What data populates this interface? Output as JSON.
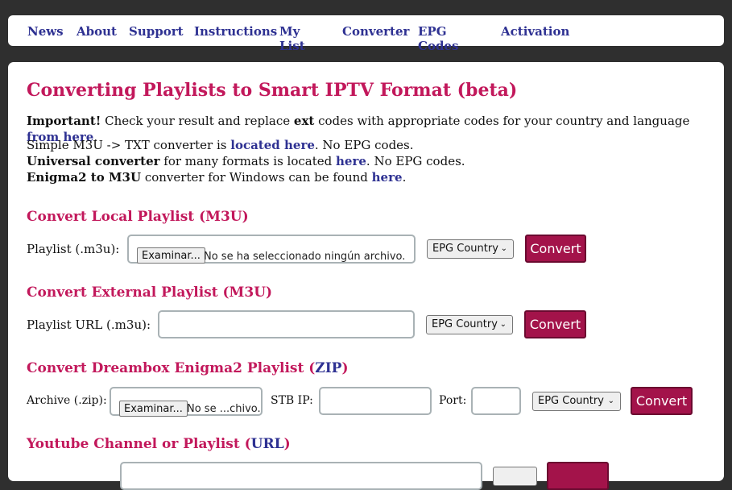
{
  "nav": [
    "News",
    "About",
    "Support",
    "Instructions",
    "My List",
    "Converter",
    "EPG Codes",
    "Activation"
  ],
  "page": {
    "title": "Converting Playlists to Smart IPTV Format (beta)",
    "important": {
      "bold": "Important!",
      "t1": " Check your result and replace ",
      "ext": "ext",
      "t2": " codes with appropriate codes for your country and language ",
      "link": "from here",
      "end": "."
    },
    "line1": {
      "t1": "Simple M3U -> TXT converter is ",
      "link": "located here",
      "end": ". No EPG codes."
    },
    "line2": {
      "bold": "Universal converter",
      "t1": " for many formats is located ",
      "link": "here",
      "end": ". No EPG codes."
    },
    "line3": {
      "bold": "Enigma2 to M3U",
      "t1": " converter for Windows can be found ",
      "link": "here",
      "end": "."
    }
  },
  "local": {
    "heading": "Convert Local Playlist (M3U)",
    "label": "Playlist (.m3u):",
    "file_button": "Examinar...",
    "file_status": "No se ha seleccionado ningún archivo.",
    "epg": "EPG Country",
    "convert": "Convert"
  },
  "external": {
    "heading": "Convert External Playlist (M3U)",
    "label": "Playlist URL (.m3u):",
    "url_value": "",
    "epg": "EPG Country",
    "convert": "Convert"
  },
  "dreambox": {
    "heading_pre": "Convert Dreambox Enigma2 Playlist (",
    "heading_zip": "ZIP",
    "heading_post": ")",
    "archive_label": "Archive (.zip):",
    "file_button": "Examinar...",
    "file_status": "No se ...chivo.",
    "stb_label": "STB IP:",
    "stb_value": "",
    "port_label": "Port:",
    "port_value": "",
    "epg": "EPG Country",
    "convert": "Convert"
  },
  "youtube": {
    "heading_pre": "Youtube Channel or Playlist (",
    "heading_url": "URL",
    "heading_post": ")"
  }
}
